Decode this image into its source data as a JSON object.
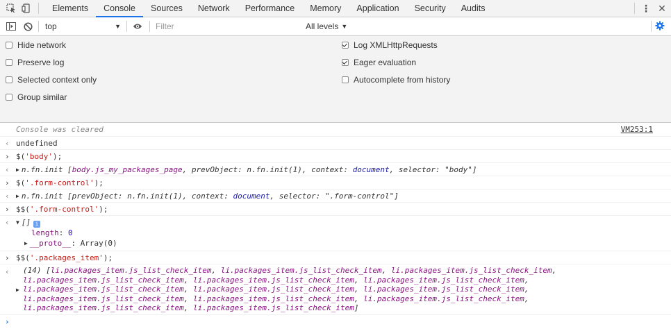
{
  "tabs": [
    "Elements",
    "Console",
    "Sources",
    "Network",
    "Performance",
    "Memory",
    "Application",
    "Security",
    "Audits"
  ],
  "active_tab": "Console",
  "toolbar": {
    "context": "top",
    "filter_placeholder": "Filter",
    "levels": "All levels"
  },
  "settings": {
    "left": [
      {
        "label": "Hide network",
        "checked": false
      },
      {
        "label": "Preserve log",
        "checked": false
      },
      {
        "label": "Selected context only",
        "checked": false
      },
      {
        "label": "Group similar",
        "checked": false
      }
    ],
    "right": [
      {
        "label": "Log XMLHttpRequests",
        "checked": true
      },
      {
        "label": "Eager evaluation",
        "checked": true
      },
      {
        "label": "Autocomplete from history",
        "checked": false
      }
    ]
  },
  "console": {
    "cleared": "Console was cleared",
    "vm_link": "VM253:1",
    "undefined": "undefined",
    "cmd1_fn": "$(",
    "cmd1_arg": "'body'",
    "cmd1_end": ");",
    "res1_prefix": "n.fn.init [",
    "res1_el": "body.js_my_packages_page",
    "res1_sep1": ", prevObject: n.fn.init(1), context: ",
    "res1_ctx": "document",
    "res1_sep2": ", selector: ",
    "res1_sel": "\"body\"",
    "res1_end": "]",
    "cmd2_fn": "$(",
    "cmd2_arg": "'.form-control'",
    "cmd2_end": ");",
    "res2_prefix": "n.fn.init [prevObject: n.fn.init(1), context: ",
    "res2_ctx": "document",
    "res2_sep": ", selector: ",
    "res2_sel": "\".form-control\"",
    "res2_end": "]",
    "cmd3_fn": "$$(",
    "cmd3_arg": "'.form-control'",
    "cmd3_end": ");",
    "res3_array": "[]",
    "res3_badge": "i",
    "res3_length_key": "length",
    "res3_length_val": "0",
    "res3_proto_key": "__proto__",
    "res3_proto_val": ": Array(0)",
    "cmd4_fn": "$$(",
    "cmd4_arg": "'.packages_item'",
    "cmd4_end": ");",
    "res4_count": "(14) [",
    "res4_item": "li.packages_item.js_list_check_item",
    "res4_close": "]"
  }
}
